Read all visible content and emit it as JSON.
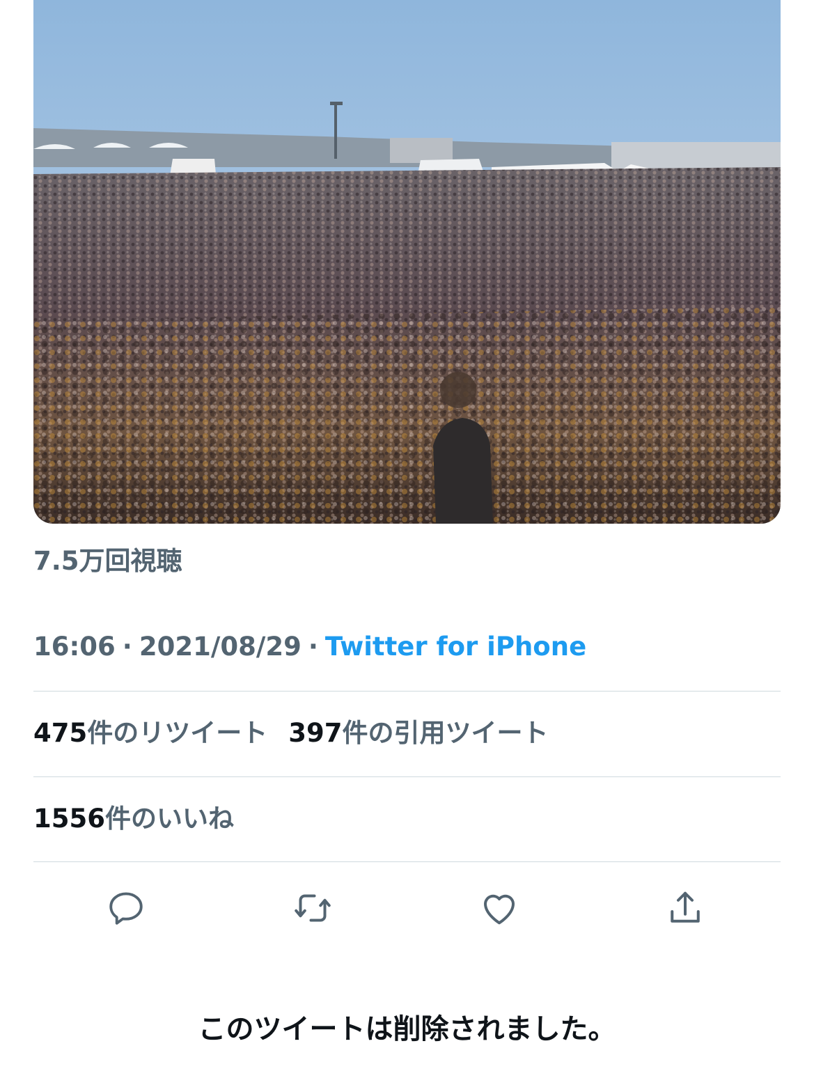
{
  "tweet": {
    "media": {
      "type": "video-thumbnail",
      "description_icon": "crowd-video"
    },
    "views": "7.5万回視聴",
    "time": "16:06",
    "date": "2021/08/29",
    "dot": "·",
    "source": "Twitter for iPhone",
    "stats": {
      "retweets": {
        "count": "475",
        "label": "件のリツイート"
      },
      "quotes": {
        "count": "397",
        "label": "件の引用ツイート"
      },
      "likes": {
        "count": "1556",
        "label": "件のいいね"
      }
    },
    "actions": [
      {
        "name": "reply",
        "icon": "reply-icon"
      },
      {
        "name": "retweet",
        "icon": "retweet-icon"
      },
      {
        "name": "like",
        "icon": "heart-icon"
      },
      {
        "name": "share",
        "icon": "share-icon"
      }
    ]
  },
  "deleted_notice": "このツイートは削除されました。",
  "colors": {
    "secondary_text": "#536471",
    "primary_text": "#0f1419",
    "link": "#1d9bf0",
    "divider": "#cfd9de",
    "icon": "#536471"
  }
}
